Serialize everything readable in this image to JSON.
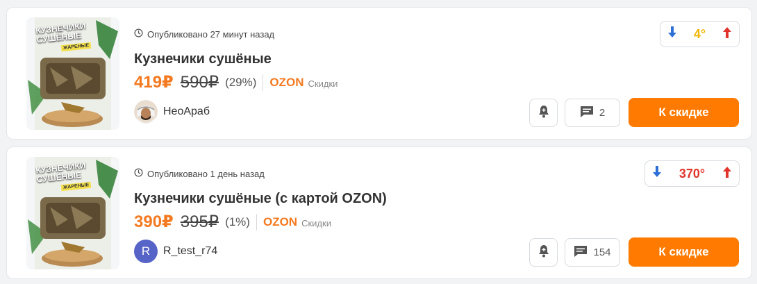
{
  "deals": [
    {
      "published": "Опубликовано 27 минут назад",
      "title": "Кузнечики сушёные",
      "price": "419₽",
      "old_price": "590₽",
      "discount": "(29%)",
      "shop": "OZON",
      "shop_sub": "Скидки",
      "author": "НеоАраб",
      "rating": "4°",
      "comments": "2",
      "cta": "К скидке",
      "image_text": {
        "line1": "КУЗНЕЧИКИ",
        "line2": "СУШЁНЫЕ",
        "badge": "ЖАРЕНЫЕ"
      }
    },
    {
      "published": "Опубликовано 1 день назад",
      "title": "Кузнечики сушёные (с картой OZON)",
      "price": "390₽",
      "old_price": "395₽",
      "discount": "(1%)",
      "shop": "OZON",
      "shop_sub": "Скидки",
      "author": "R_test_r74",
      "author_initial": "R",
      "rating": "370°",
      "comments": "154",
      "cta": "К скидке",
      "image_text": {
        "line1": "КУЗНЕЧИКИ",
        "line2": "СУШЁНЫЕ",
        "badge": "ЖАРЕНЫЕ"
      }
    }
  ],
  "colors": {
    "accent": "#ff7a00",
    "price": "#f37a20",
    "vote_down": "#2c6fd6",
    "vote_up": "#e0342b",
    "rating_warm": "#f2b705",
    "rating_hot": "#e0342b"
  },
  "icons": [
    "clock-icon",
    "arrow-down-icon",
    "arrow-up-icon",
    "bell-icon",
    "comment-icon"
  ]
}
